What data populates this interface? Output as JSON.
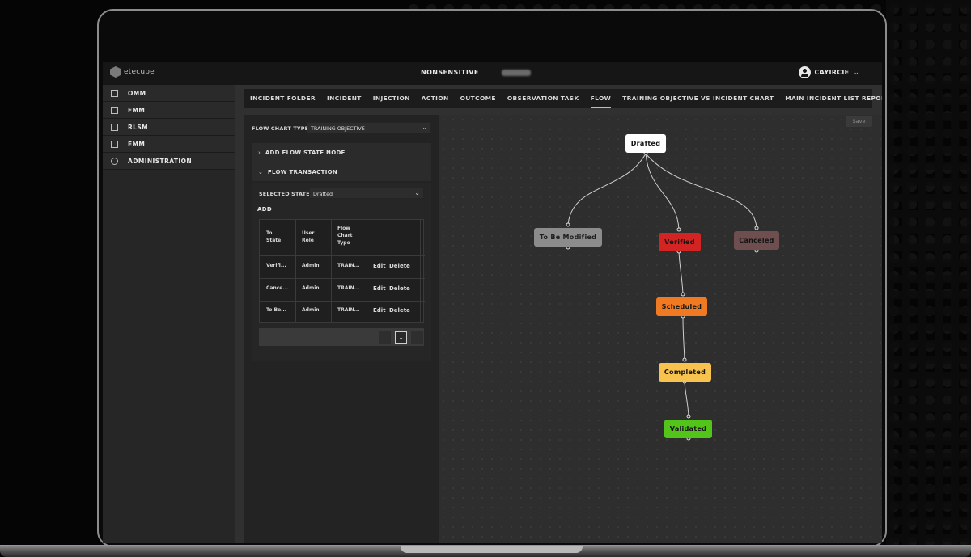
{
  "app": {
    "logo": "etecube",
    "environment": "NONSENSITIVE",
    "user": "CAYIRCIE"
  },
  "sidebar": {
    "items": [
      {
        "label": "OMM",
        "icon": "cube-icon"
      },
      {
        "label": "FMM",
        "icon": "cube-icon"
      },
      {
        "label": "RLSM",
        "icon": "cube-icon"
      },
      {
        "label": "EMM",
        "icon": "cube-icon"
      },
      {
        "label": "ADMINISTRATION",
        "icon": "users-icon"
      }
    ]
  },
  "tabs": [
    {
      "label": "INCIDENT FOLDER"
    },
    {
      "label": "INCIDENT"
    },
    {
      "label": "INJECTION"
    },
    {
      "label": "ACTION"
    },
    {
      "label": "OUTCOME"
    },
    {
      "label": "OBSERVATION TASK"
    },
    {
      "label": "FLOW",
      "active": true
    },
    {
      "label": "TRAINING OBJECTIVE VS INCIDENT CHART"
    },
    {
      "label": "MAIN INCIDENT LIST REPORT"
    }
  ],
  "panel": {
    "chart_type_label": "FLOW CHART TYPE:",
    "chart_type_value": "TRAINING OBJECTIVE",
    "add_node_label": "ADD FLOW STATE NODE",
    "transaction_label": "FLOW TRANSACTION",
    "selected_state_label": "SELECTED STATE:",
    "selected_state_value": "Drafted",
    "add_label": "ADD",
    "table": {
      "headers": [
        "To\nState",
        "User\nRole",
        "Flow\nChart\nType",
        ""
      ],
      "rows": [
        {
          "to_state": "Verifi...",
          "role": "Admin",
          "type": "TRAIN...",
          "edit": "Edit",
          "delete": "Delete"
        },
        {
          "to_state": "Cance...",
          "role": "Admin",
          "type": "TRAIN...",
          "edit": "Edit",
          "delete": "Delete"
        },
        {
          "to_state": "To Be...",
          "role": "Admin",
          "type": "TRAIN...",
          "edit": "Edit",
          "delete": "Delete"
        }
      ]
    },
    "page": "1"
  },
  "canvas": {
    "save_label": "Save",
    "nodes": [
      {
        "id": "drafted",
        "label": "Drafted",
        "color": "#ffffff"
      },
      {
        "id": "to-be-modified",
        "label": "To Be Modified",
        "color": "#8c8c8c"
      },
      {
        "id": "verified",
        "label": "Verified",
        "color": "#d32424"
      },
      {
        "id": "canceled",
        "label": "Canceled",
        "color": "#6e4e4e"
      },
      {
        "id": "scheduled",
        "label": "Scheduled",
        "color": "#ef7a22"
      },
      {
        "id": "completed",
        "label": "Completed",
        "color": "#f7c24e"
      },
      {
        "id": "validated",
        "label": "Validated",
        "color": "#52c41a"
      }
    ]
  }
}
